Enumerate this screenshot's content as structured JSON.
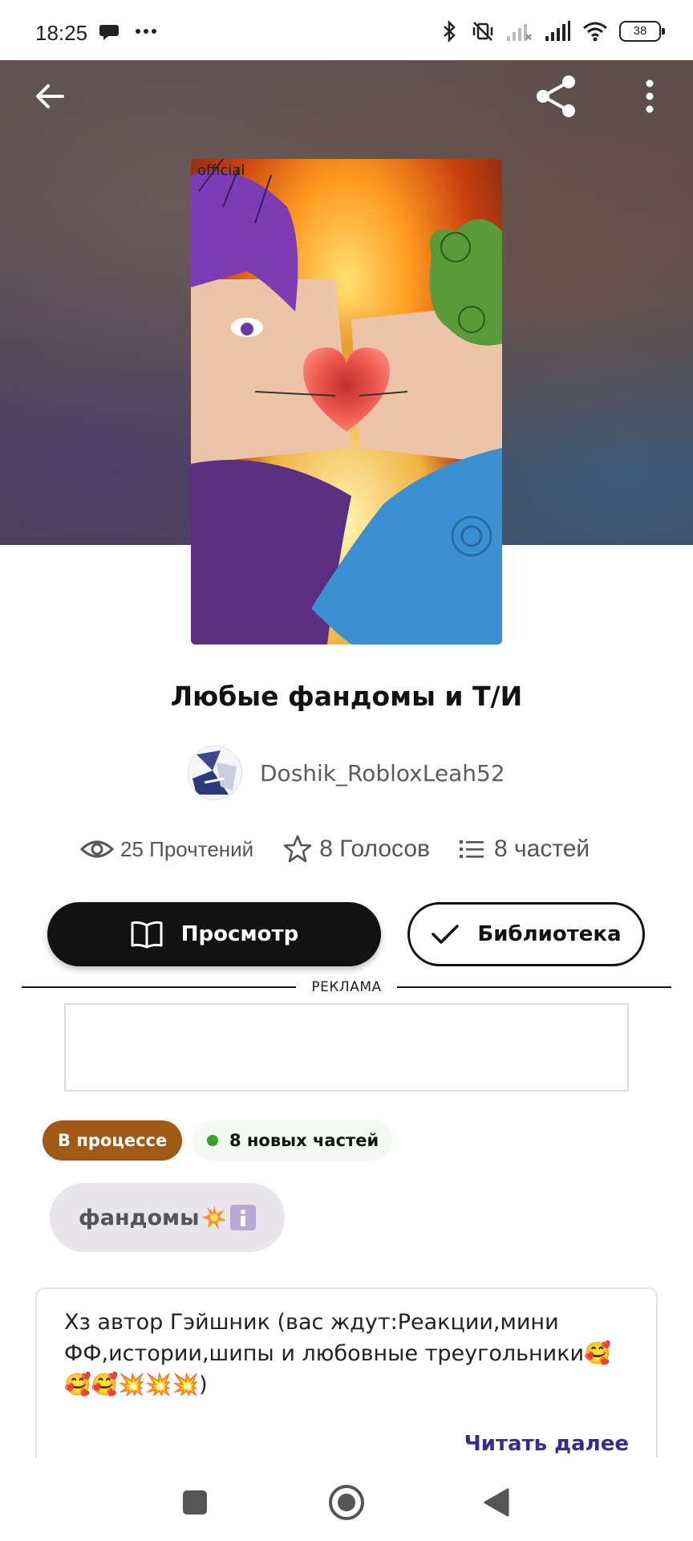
{
  "status_bar": {
    "time": "18:25",
    "left_icons": [
      "chat-bubble-icon",
      "more-dots-icon"
    ],
    "right_icons": [
      "bluetooth-icon",
      "vibrate-off-icon",
      "signal-weak-icon",
      "signal-strong-icon",
      "wifi-icon"
    ],
    "battery": "38"
  },
  "header": {
    "back_icon": "arrow-left-icon",
    "share_icon": "share-icon",
    "more_icon": "more-vertical-icon"
  },
  "cover": {
    "watermark": "official"
  },
  "story": {
    "title": "Любые фандомы и Т/И",
    "author": "Doshik_RobloxLeah52",
    "reads": "25 Прочтений",
    "votes": "8 Голосов",
    "parts": "8 частей"
  },
  "actions": {
    "view_label": "Просмотр",
    "library_label": "Библиотека"
  },
  "ad": {
    "label": "РЕКЛАМА"
  },
  "status": {
    "state_label": "В процессе",
    "new_parts_label": "8 новых частей"
  },
  "tags": [
    {
      "label": "фандомы"
    }
  ],
  "description": {
    "text": "Хз автор Гэйшник (вас ждут:Реакции,мини ФФ,истории,шипы и любовные треугольники🥰🥰🥰💥💥💥)",
    "read_more": "Читать далее"
  },
  "colors": {
    "status_chip": "#a05a14",
    "new_dot": "#3ca028",
    "link": "#3a2a8e",
    "primary_button": "#121212"
  }
}
